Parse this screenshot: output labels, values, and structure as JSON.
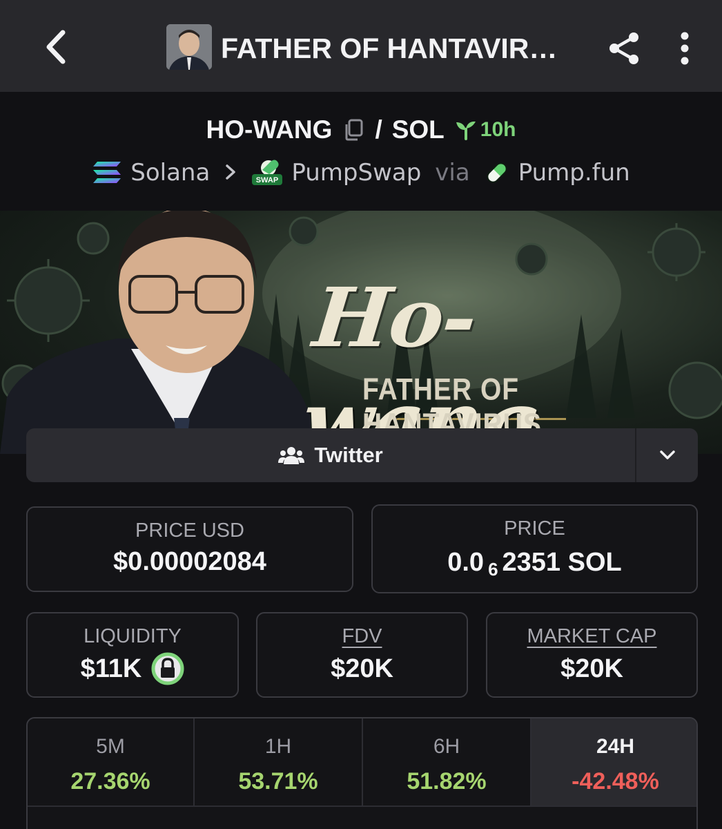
{
  "header": {
    "title": "FATHER OF HANTAVIR…"
  },
  "pair": {
    "base": "HO-WANG",
    "separator": "/",
    "quote": "SOL",
    "age": "10h"
  },
  "chain": {
    "network": "Solana",
    "dex": "PumpSwap",
    "via": "via",
    "launchpad": "Pump.fun",
    "dex_badge_text": "SWAP"
  },
  "banner": {
    "name": "Ho-wang",
    "subtitle": "FATHER OF HANTAVIRUS"
  },
  "links": {
    "twitter_label": "Twitter"
  },
  "stats": {
    "price_usd_label": "PRICE USD",
    "price_usd_value": "$0.00002084",
    "price_label": "PRICE",
    "price_prefix": "0.0",
    "price_zeros_sub": "6",
    "price_suffix": "2351 SOL",
    "liquidity_label": "LIQUIDITY",
    "liquidity_value": "$11K",
    "fdv_label": "FDV",
    "fdv_value": "$20K",
    "mcap_label": "MARKET CAP",
    "mcap_value": "$20K"
  },
  "timeframes": [
    {
      "label": "5M",
      "value": "27.36%",
      "color": "#a6d56f"
    },
    {
      "label": "1H",
      "value": "53.71%",
      "color": "#a6d56f"
    },
    {
      "label": "6H",
      "value": "51.82%",
      "color": "#a6d56f"
    },
    {
      "label": "24H",
      "value": "-42.48%",
      "color": "#ef5f5a",
      "active": true
    }
  ],
  "colors": {
    "accent_green": "#7ed37a",
    "negative": "#ef5f5a",
    "positive": "#a6d56f"
  }
}
